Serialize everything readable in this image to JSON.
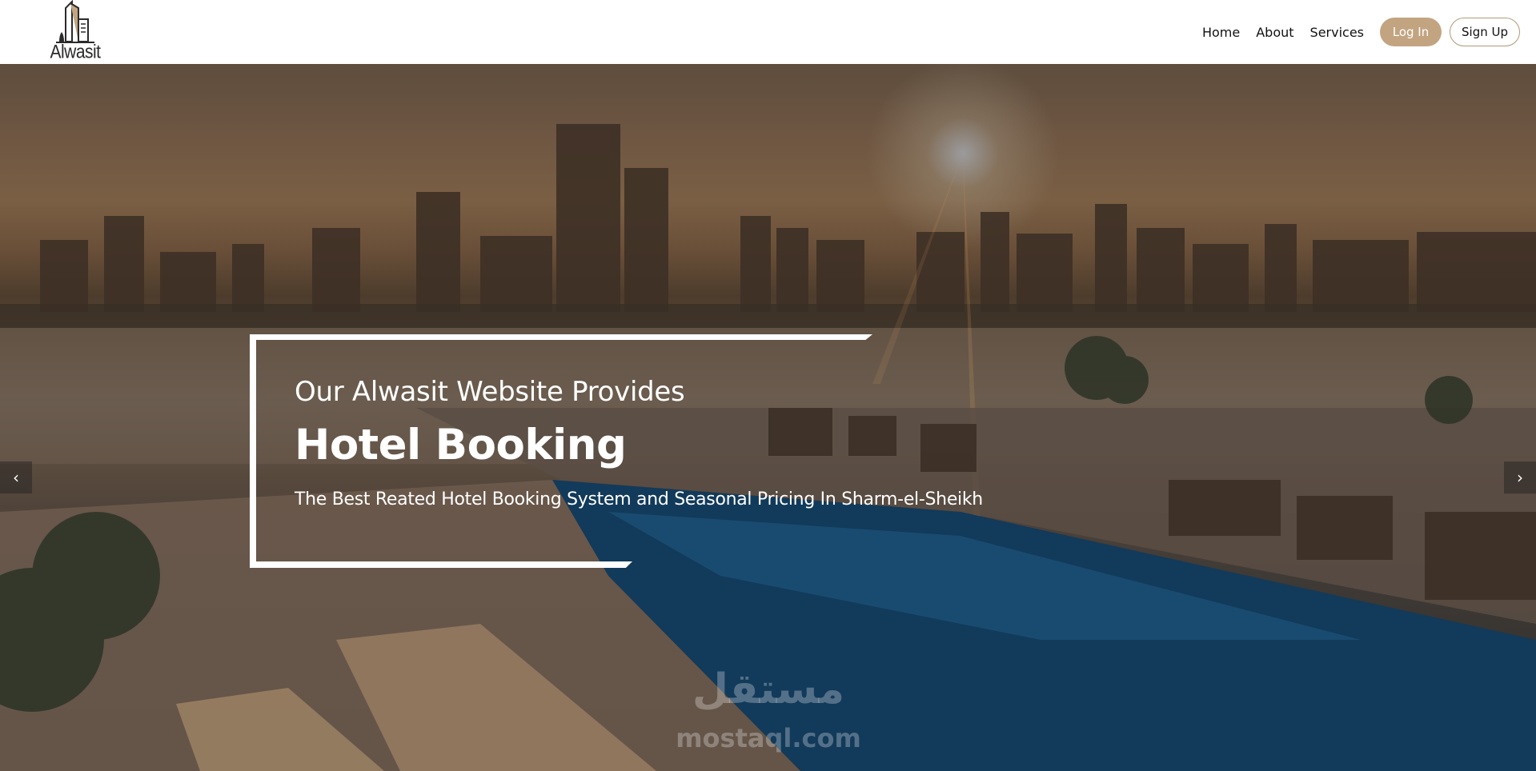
{
  "brand": {
    "name": "Alwasit"
  },
  "nav": {
    "links": [
      "Home",
      "About",
      "Services"
    ],
    "login_label": "Log In",
    "signup_label": "Sign Up"
  },
  "hero": {
    "line1": "Our Alwasit Website Provides",
    "line2": "Hotel Booking",
    "line3": "The Best Reated Hotel Booking System and Seasonal Pricing In Sharm-el-Sheikh",
    "prev_icon": "‹",
    "next_icon": "›"
  },
  "watermark": {
    "arabic": "مستقل",
    "latin": "mostaql.com"
  },
  "colors": {
    "accent": "#c3a481",
    "signup_border": "#b39878",
    "nav_bg": "#ffffff"
  },
  "icons": {
    "logo": "building-logo-icon",
    "prev": "chevron-left-icon",
    "next": "chevron-right-icon"
  }
}
